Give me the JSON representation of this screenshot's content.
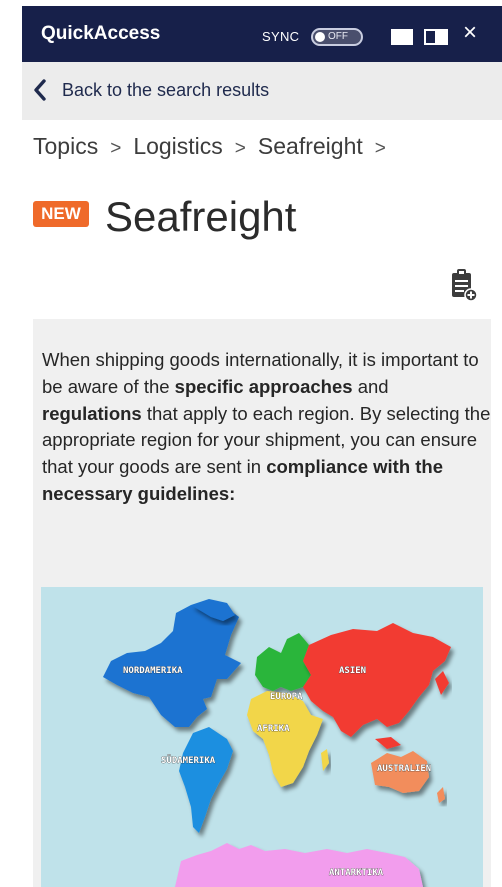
{
  "header": {
    "app_title": "QuickAccess",
    "sync_label": "SYNC",
    "sync_toggle": "OFF",
    "close_glyph": "×"
  },
  "backbar": {
    "label": "Back to the search results"
  },
  "breadcrumb": {
    "items": [
      "Topics",
      "Logistics",
      "Seafreight"
    ],
    "separator": ">"
  },
  "article": {
    "badge": "NEW",
    "title": "Seafreight",
    "intro": {
      "p1": "When shipping goods internationally, it is important to be aware of the ",
      "b1": "specific approaches",
      "p2": " and ",
      "b2": "regulations",
      "p3": " that apply to each region. By selecting the appropriate region for your shipment, you can ensure that your goods are sent in ",
      "b3": "compliance with the necessary guidelines:"
    }
  },
  "map": {
    "regions": {
      "north_america": "NORDAMERIKA",
      "south_america": "SÜDAMERIKA",
      "europe": "EUROPA",
      "africa": "AFRIKA",
      "asia": "ASIEN",
      "australia": "AUSTRALIEN",
      "antarctica": "ANTARKTIKA"
    }
  },
  "colors": {
    "header_bg": "#17204a",
    "badge": "#ef6a2a",
    "north_america": "#1a73d1",
    "south_america": "#1f8fe0",
    "europe": "#2cb53a",
    "africa": "#f2d648",
    "asia": "#f23a33",
    "australia": "#f28d5b",
    "antarctica": "#f29ded"
  },
  "icons": [
    "back-chevron-icon",
    "clipboard-add-icon",
    "window-single-icon",
    "window-split-icon",
    "close-icon"
  ]
}
